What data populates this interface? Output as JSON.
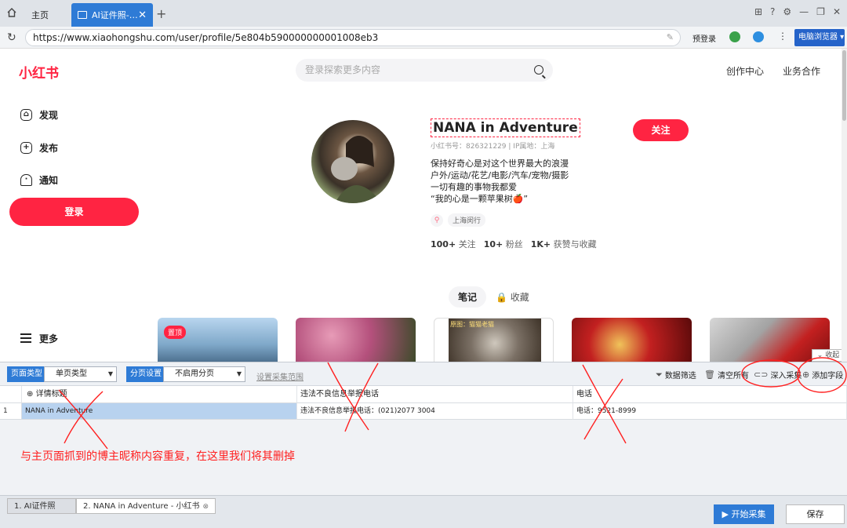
{
  "browser": {
    "tabs": [
      {
        "label": "主页"
      },
      {
        "label": "AI证件照-…"
      }
    ],
    "url": "https://www.xiaohongshu.com/user/profile/5e804b590000000001008eb3",
    "pre_login": "预登录",
    "browser_menu": "电脑浏览器"
  },
  "site": {
    "logo": "小红书",
    "search_placeholder": "登录探索更多内容",
    "top_links": [
      "创作中心",
      "业务合作"
    ],
    "nav": [
      {
        "label": "发现"
      },
      {
        "label": "发布"
      },
      {
        "label": "通知"
      }
    ],
    "login_label": "登录",
    "more_label": "更多"
  },
  "profile": {
    "name": "NANA in Adventure",
    "id_line": "小红书号：826321229 | IP属地：上海",
    "follow_label": "关注",
    "bio": [
      "保持好奇心是对这个世界最大的浪漫",
      "户外/运动/花艺/电影/汽车/宠物/摄影",
      "一切有趣的事物我都爱",
      "“我的心是一颗苹果树🍎”"
    ],
    "location": "上海闵行",
    "stats": [
      {
        "num": "100+",
        "label": "关注"
      },
      {
        "num": "10+",
        "label": "粉丝"
      },
      {
        "num": "1K+",
        "label": "获赞与收藏"
      }
    ],
    "tabs": [
      "笔记",
      "收藏"
    ],
    "pinned_badge": "置顶",
    "card_caption": "原图：猫猫老猫",
    "collapse_label": "收起"
  },
  "scraper": {
    "page_type_label": "页面类型",
    "page_type_value": "单页类型",
    "paging_label": "分页设置",
    "paging_value": "不启用分页",
    "range_link": "设置采集范围",
    "tools": {
      "filter": "数据筛选",
      "clear": "清空所有",
      "deep": "深入采集",
      "add_field": "添加字段"
    },
    "columns": [
      "详情标题",
      "违法不良信息举报电话",
      "电话"
    ],
    "rows": [
      {
        "index": "1",
        "cells": [
          "NANA in Adventure",
          "违法不良信息举报电话：(021)2077 3004",
          "电话：9521-8999"
        ]
      }
    ],
    "annotation": "与主页面抓到的博主昵称内容重复，在这里我们将其删掉",
    "bottom_tabs": [
      "1. AI证件照",
      "2. NANA in Adventure - 小红书"
    ],
    "start_label": "开始采集",
    "save_label": "保存"
  },
  "colors": {
    "brand": "#ff2442",
    "accent": "#2e7bd6",
    "annotation": "#ff2020"
  }
}
